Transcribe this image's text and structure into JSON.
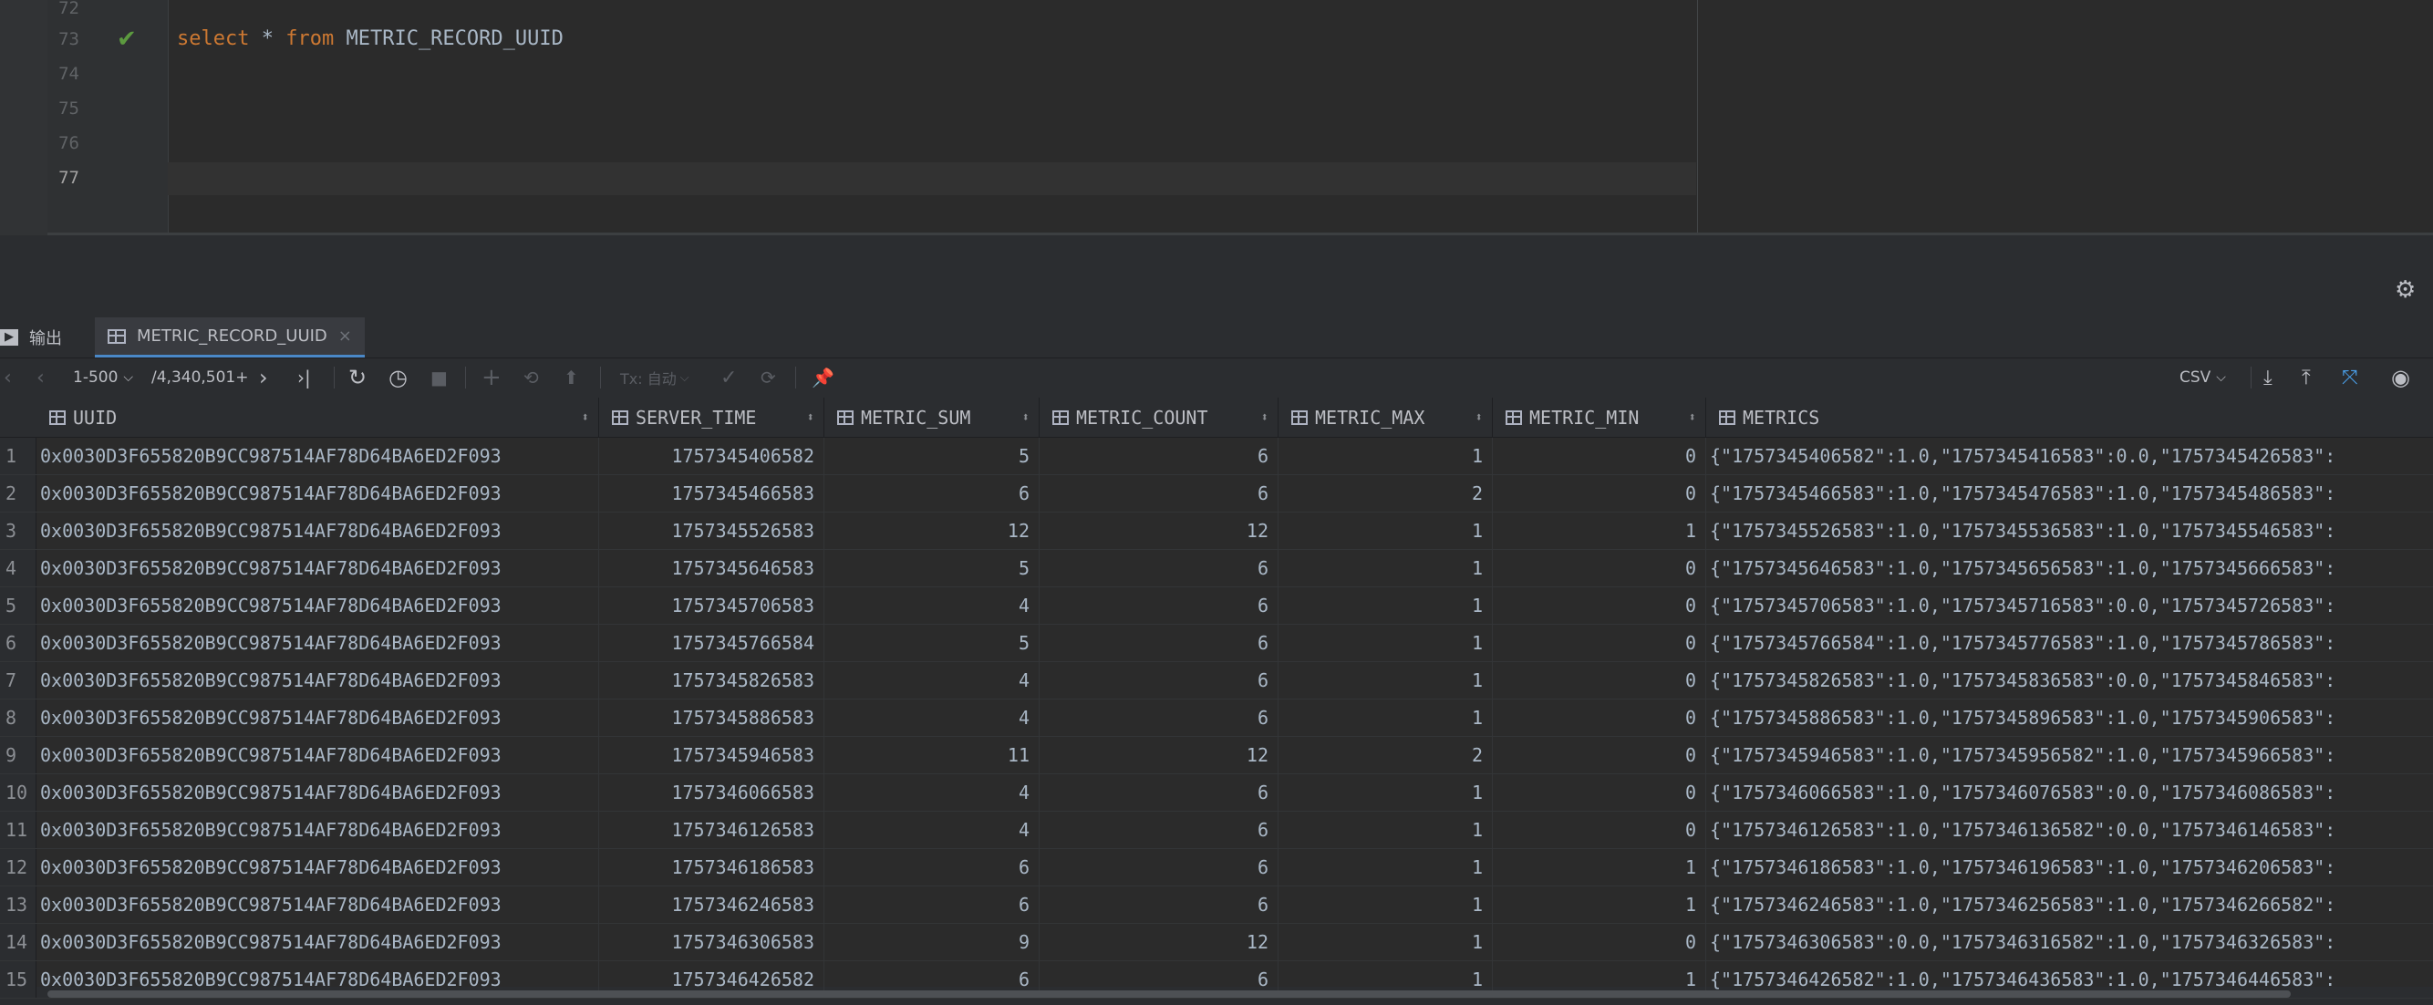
{
  "editor": {
    "line_numbers": [
      "72",
      "73",
      "74",
      "75",
      "76",
      "77"
    ],
    "code": {
      "kw_select": "select",
      "star": "*",
      "kw_from": "from",
      "table": "METRIC_RECORD_UUID"
    }
  },
  "tabs": {
    "output_label": "输出",
    "result_label": "METRIC_RECORD_UUID",
    "close_glyph": "×"
  },
  "toolbar": {
    "page_range": "1-500",
    "total": "/4,340,501+",
    "tx_label": "Tx: 自动",
    "export_format": "CSV"
  },
  "columns": [
    "UUID",
    "SERVER_TIME",
    "METRIC_SUM",
    "METRIC_COUNT",
    "METRIC_MAX",
    "METRIC_MIN",
    "METRICS"
  ],
  "rows": [
    [
      "1",
      "0x0030D3F655820B9CC987514AF78D64BA6ED2F093",
      "1757345406582",
      "5",
      "6",
      "1",
      "0",
      "{\"1757345406582\":1.0,\"1757345416583\":0.0,\"1757345426583\":"
    ],
    [
      "2",
      "0x0030D3F655820B9CC987514AF78D64BA6ED2F093",
      "1757345466583",
      "6",
      "6",
      "2",
      "0",
      "{\"1757345466583\":1.0,\"1757345476583\":1.0,\"1757345486583\":"
    ],
    [
      "3",
      "0x0030D3F655820B9CC987514AF78D64BA6ED2F093",
      "1757345526583",
      "12",
      "12",
      "1",
      "1",
      "{\"1757345526583\":1.0,\"1757345536583\":1.0,\"1757345546583\":"
    ],
    [
      "4",
      "0x0030D3F655820B9CC987514AF78D64BA6ED2F093",
      "1757345646583",
      "5",
      "6",
      "1",
      "0",
      "{\"1757345646583\":1.0,\"1757345656583\":1.0,\"1757345666583\":"
    ],
    [
      "5",
      "0x0030D3F655820B9CC987514AF78D64BA6ED2F093",
      "1757345706583",
      "4",
      "6",
      "1",
      "0",
      "{\"1757345706583\":1.0,\"1757345716583\":0.0,\"1757345726583\":"
    ],
    [
      "6",
      "0x0030D3F655820B9CC987514AF78D64BA6ED2F093",
      "1757345766584",
      "5",
      "6",
      "1",
      "0",
      "{\"1757345766584\":1.0,\"1757345776583\":1.0,\"1757345786583\":"
    ],
    [
      "7",
      "0x0030D3F655820B9CC987514AF78D64BA6ED2F093",
      "1757345826583",
      "4",
      "6",
      "1",
      "0",
      "{\"1757345826583\":1.0,\"1757345836583\":0.0,\"1757345846583\":"
    ],
    [
      "8",
      "0x0030D3F655820B9CC987514AF78D64BA6ED2F093",
      "1757345886583",
      "4",
      "6",
      "1",
      "0",
      "{\"1757345886583\":1.0,\"1757345896583\":1.0,\"1757345906583\":"
    ],
    [
      "9",
      "0x0030D3F655820B9CC987514AF78D64BA6ED2F093",
      "1757345946583",
      "11",
      "12",
      "2",
      "0",
      "{\"1757345946583\":1.0,\"1757345956582\":1.0,\"1757345966583\":"
    ],
    [
      "10",
      "0x0030D3F655820B9CC987514AF78D64BA6ED2F093",
      "1757346066583",
      "4",
      "6",
      "1",
      "0",
      "{\"1757346066583\":1.0,\"1757346076583\":0.0,\"1757346086583\":"
    ],
    [
      "11",
      "0x0030D3F655820B9CC987514AF78D64BA6ED2F093",
      "1757346126583",
      "4",
      "6",
      "1",
      "0",
      "{\"1757346126583\":1.0,\"1757346136582\":0.0,\"1757346146583\":"
    ],
    [
      "12",
      "0x0030D3F655820B9CC987514AF78D64BA6ED2F093",
      "1757346186583",
      "6",
      "6",
      "1",
      "1",
      "{\"1757346186583\":1.0,\"1757346196583\":1.0,\"1757346206583\":"
    ],
    [
      "13",
      "0x0030D3F655820B9CC987514AF78D64BA6ED2F093",
      "1757346246583",
      "6",
      "6",
      "1",
      "1",
      "{\"1757346246583\":1.0,\"1757346256583\":1.0,\"1757346266582\":"
    ],
    [
      "14",
      "0x0030D3F655820B9CC987514AF78D64BA6ED2F093",
      "1757346306583",
      "9",
      "12",
      "1",
      "0",
      "{\"1757346306583\":0.0,\"1757346316582\":1.0,\"1757346326583\":"
    ],
    [
      "15",
      "0x0030D3F655820B9CC987514AF78D64BA6ED2F093",
      "1757346426582",
      "6",
      "6",
      "1",
      "1",
      "{\"1757346426582\":1.0,\"1757346436583\":1.0,\"1757346446583\":"
    ]
  ]
}
